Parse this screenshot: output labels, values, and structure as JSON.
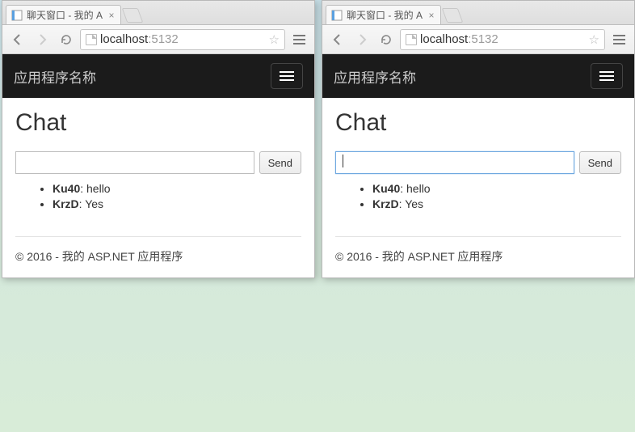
{
  "titlebar": {
    "min": "—",
    "max": "▢",
    "close": "✕"
  },
  "browser": {
    "tab_title": "聊天窗口 - 我的 A",
    "tab_close": "×",
    "newtab": "+",
    "address_host": "localhost",
    "address_port": ":5132",
    "star": "☆"
  },
  "page": {
    "brand": "应用程序名称",
    "heading": "Chat",
    "send_btn": "Send",
    "footer": "© 2016 - 我的 ASP.NET 应用程序"
  },
  "messages": [
    {
      "user": "Ku40",
      "text": "hello"
    },
    {
      "user": "KrzD",
      "text": "Yes"
    }
  ],
  "left_input_value": "",
  "right_input_value": ""
}
